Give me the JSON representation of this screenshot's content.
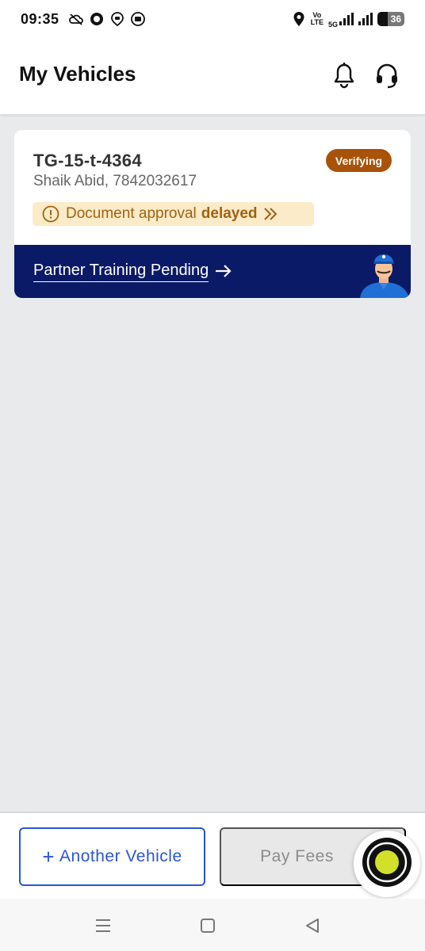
{
  "status_bar": {
    "time": "09:35",
    "volte_line1": "Vo",
    "volte_line2": "LTE",
    "network": "5G",
    "battery": "36",
    "icons": [
      "cloud-off-icon",
      "circle-icon",
      "chat-location-icon",
      "media-icon",
      "location-pin-icon",
      "signal-icon",
      "signal-icon",
      "battery-icon"
    ]
  },
  "header": {
    "title": "My Vehicles",
    "icons": [
      "bell-icon",
      "headset-icon"
    ]
  },
  "vehicle": {
    "number": "TG-15-t-4364",
    "owner": "Shaik Abid, 7842032617",
    "status": "Verifying",
    "status_color": "#a9520a",
    "alert_text": "Document approval",
    "alert_emphasis": "delayed",
    "training_text": "Partner Training Pending"
  },
  "actions": {
    "add_vehicle_prefix": "+",
    "add_vehicle": "Another Vehicle",
    "pay_fees": "Pay Fees"
  },
  "colors": {
    "banner": "#0b1a67",
    "accent_blue": "#2a55d6",
    "alert_bg": "#fcebc8",
    "alert_text": "#a06212",
    "fab_dot": "#d2e02a"
  },
  "nav": {
    "icons": [
      "menu-icon",
      "home-square-icon",
      "back-triangle-icon"
    ]
  }
}
